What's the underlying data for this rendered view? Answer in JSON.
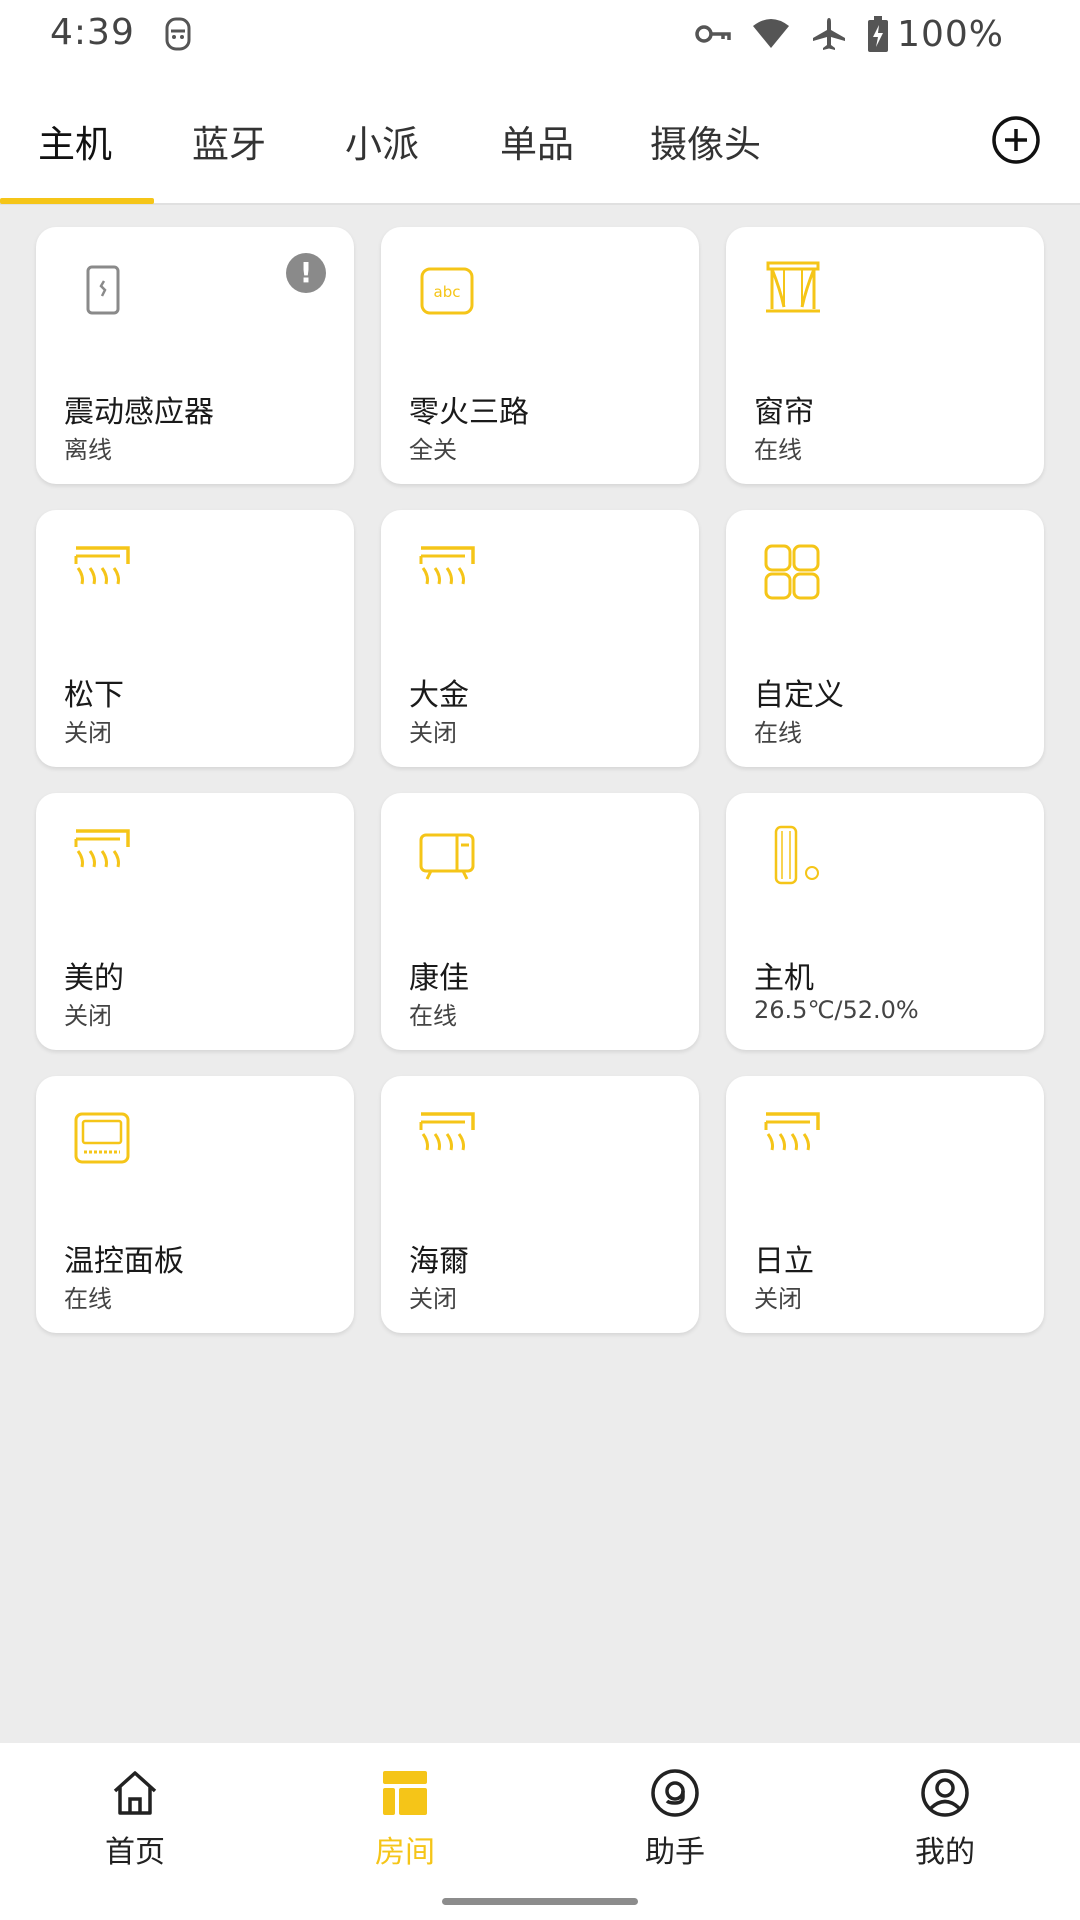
{
  "status_bar": {
    "time": "4:39",
    "battery": "100%",
    "icons": [
      "vpn-key-icon",
      "wifi-icon",
      "airplane-icon",
      "battery-charging-icon"
    ]
  },
  "tabs": [
    {
      "label": "主机",
      "active": true
    },
    {
      "label": "蓝牙",
      "active": false
    },
    {
      "label": "小派",
      "active": false
    },
    {
      "label": "单品",
      "active": false
    },
    {
      "label": "摄像头",
      "active": false
    }
  ],
  "colors": {
    "accent": "#f5c518",
    "background": "#ececec",
    "card": "#ffffff",
    "offline_icon": "#8a8a8a"
  },
  "devices": [
    {
      "name": "震动感应器",
      "status": "离线",
      "icon": "vibration-sensor-icon",
      "alert": "!"
    },
    {
      "name": "零火三路",
      "status": "全关",
      "icon": "switch-panel-icon"
    },
    {
      "name": "窗帘",
      "status": "在线",
      "icon": "curtain-icon"
    },
    {
      "name": "松下",
      "status": "关闭",
      "icon": "air-conditioner-icon"
    },
    {
      "name": "大金",
      "status": "关闭",
      "icon": "air-conditioner-icon"
    },
    {
      "name": "自定义",
      "status": "在线",
      "icon": "custom-grid-icon"
    },
    {
      "name": "美的",
      "status": "关闭",
      "icon": "air-conditioner-icon"
    },
    {
      "name": "康佳",
      "status": "在线",
      "icon": "tv-icon"
    },
    {
      "name": "主机",
      "status": "26.5℃/52.0%",
      "icon": "hub-icon"
    },
    {
      "name": "温控面板",
      "status": "在线",
      "icon": "thermostat-panel-icon"
    },
    {
      "name": "海爾",
      "status": "关闭",
      "icon": "air-conditioner-icon"
    },
    {
      "name": "日立",
      "status": "关闭",
      "icon": "air-conditioner-icon"
    }
  ],
  "bottom_nav": [
    {
      "label": "首页",
      "icon": "home-icon",
      "active": false
    },
    {
      "label": "房间",
      "icon": "room-icon",
      "active": true
    },
    {
      "label": "助手",
      "icon": "assistant-icon",
      "active": false
    },
    {
      "label": "我的",
      "icon": "profile-icon",
      "active": false
    }
  ]
}
